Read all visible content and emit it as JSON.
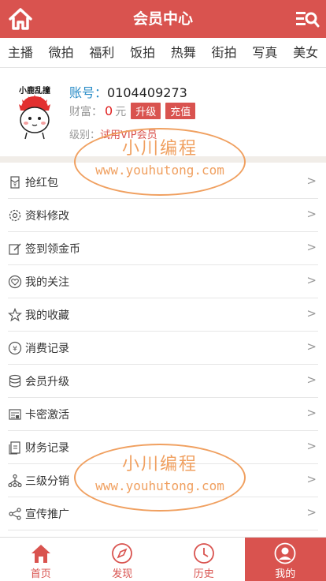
{
  "header": {
    "title": "会员中心",
    "home_icon": "home-icon",
    "menu_icon": "search-menu-icon"
  },
  "categories": [
    "主播",
    "微拍",
    "福利",
    "饭拍",
    "热舞",
    "街拍",
    "写真",
    "美女"
  ],
  "profile": {
    "avatar_caption": "小鹿乱撞",
    "account_label": "账号：",
    "account_value": "0104409273",
    "wealth_label": "财富：",
    "wealth_value": "0",
    "wealth_unit": "元",
    "upgrade_btn": "升级",
    "recharge_btn": "充值",
    "level_label": "级别：",
    "level_value": "试用VIP会员"
  },
  "menu": [
    {
      "label": "抢红包",
      "icon": "red-packet-icon"
    },
    {
      "label": "资料修改",
      "icon": "gear-icon"
    },
    {
      "label": "签到领金币",
      "icon": "edit-icon"
    },
    {
      "label": "我的关注",
      "icon": "heart-icon"
    },
    {
      "label": "我的收藏",
      "icon": "star-icon"
    },
    {
      "label": "消费记录",
      "icon": "yuan-icon"
    },
    {
      "label": "会员升级",
      "icon": "database-icon"
    },
    {
      "label": "卡密激活",
      "icon": "card-icon"
    },
    {
      "label": "财务记录",
      "icon": "document-icon"
    },
    {
      "label": "三级分销",
      "icon": "hierarchy-icon"
    },
    {
      "label": "宣传推广",
      "icon": "share-icon"
    }
  ],
  "arrow": ">",
  "watermark": {
    "line1": "小川编程",
    "line2": "www.youhutong.com"
  },
  "tabs": [
    {
      "label": "首页",
      "icon": "home-icon"
    },
    {
      "label": "发现",
      "icon": "compass-icon"
    },
    {
      "label": "历史",
      "icon": "clock-icon"
    },
    {
      "label": "我的",
      "icon": "user-icon"
    }
  ],
  "colors": {
    "brand": "#d9534f",
    "link": "#2a8cc7",
    "watermark": "#f0a060"
  }
}
